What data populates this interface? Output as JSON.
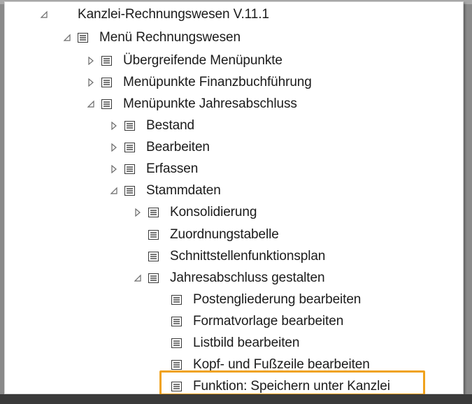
{
  "tree": {
    "nodes": [
      {
        "label": "Kanzlei-Rechnungswesen V.11.1",
        "state": "expanded",
        "has_icon": false
      },
      {
        "label": "Menü Rechnungswesen",
        "state": "expanded",
        "has_icon": true
      },
      {
        "label": "Übergreifende Menüpunkte",
        "state": "collapsed",
        "has_icon": true
      },
      {
        "label": "Menüpunkte Finanzbuchführung",
        "state": "collapsed",
        "has_icon": true
      },
      {
        "label": "Menüpunkte Jahresabschluss",
        "state": "expanded",
        "has_icon": true
      },
      {
        "label": "Bestand",
        "state": "collapsed",
        "has_icon": true
      },
      {
        "label": "Bearbeiten",
        "state": "collapsed",
        "has_icon": true
      },
      {
        "label": "Erfassen",
        "state": "collapsed",
        "has_icon": true
      },
      {
        "label": "Stammdaten",
        "state": "expanded",
        "has_icon": true
      },
      {
        "label": "Konsolidierung",
        "state": "collapsed",
        "has_icon": true
      },
      {
        "label": "Zuordnungstabelle",
        "state": "leaf",
        "has_icon": true
      },
      {
        "label": "Schnittstellenfunktionsplan",
        "state": "leaf",
        "has_icon": true
      },
      {
        "label": "Jahresabschluss gestalten",
        "state": "expanded",
        "has_icon": true
      },
      {
        "label": "Postengliederung bearbeiten",
        "state": "leaf",
        "has_icon": true
      },
      {
        "label": "Formatvorlage bearbeiten",
        "state": "leaf",
        "has_icon": true
      },
      {
        "label": "Listbild bearbeiten",
        "state": "leaf",
        "has_icon": true
      },
      {
        "label": "Kopf- und Fußzeile bearbeiten",
        "state": "leaf",
        "has_icon": true
      },
      {
        "label": "Funktion: Speichern unter Kanzlei",
        "state": "leaf",
        "has_icon": true,
        "highlighted": true
      }
    ]
  },
  "colors": {
    "highlight": "#f0a21d",
    "text": "#1b1b1b",
    "expander": "#6b6b6b"
  }
}
